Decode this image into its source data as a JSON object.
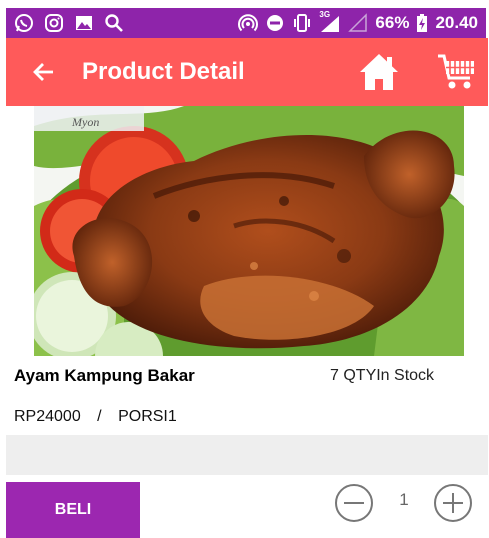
{
  "status_bar": {
    "battery": "66%",
    "time": "20.40",
    "network": "3G",
    "icons": [
      "whatsapp-icon",
      "instagram-icon",
      "gallery-icon",
      "search-icon",
      "hotspot-icon",
      "do-not-disturb-icon",
      "vibrate-icon",
      "signal-icon",
      "no-signal-icon",
      "battery-charging-icon"
    ]
  },
  "toolbar": {
    "title": "Product Detail",
    "back_icon": "arrow-back-icon",
    "home_icon": "home-icon",
    "cart_icon": "shopping-cart-icon",
    "color": "#ff5a5a"
  },
  "product": {
    "image_watermark": "Myon",
    "name": "Ayam Kampung Bakar",
    "stock": "7 QTYIn Stock",
    "price": "RP24000",
    "separator": "/",
    "unit": "PORSI1"
  },
  "actions": {
    "buy_label": "BELI",
    "buy_color": "#9c27b0",
    "quantity": "1",
    "minus_icon": "minus-circle-icon",
    "plus_icon": "plus-circle-icon"
  },
  "colors": {
    "status_bar": "#8e24aa"
  }
}
